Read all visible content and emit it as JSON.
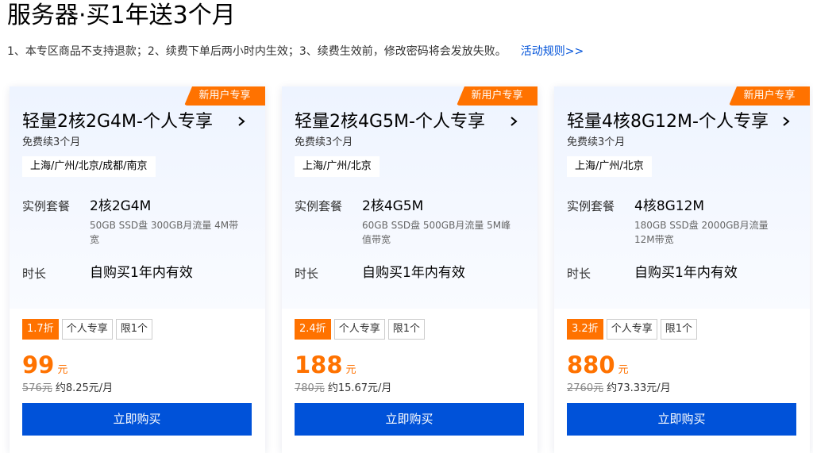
{
  "page": {
    "title": "服务器·买1年送3个月",
    "notice": "1、本专区商品不支持退款；2、续费下单后两小时内生效；3、续费生效前，修改密码将会发放失败。",
    "rules_link": "活动规则>>"
  },
  "labels": {
    "instance": "实例套餐",
    "duration": "时长",
    "buy": "立即购买"
  },
  "colors": {
    "accent_orange": "#ff7200",
    "primary_blue": "#0052d9"
  },
  "cards": [
    {
      "badge": "新用户专享",
      "title": "轻量2核2G4M-个人专享",
      "subtitle": "免费续3个月",
      "regions": "上海/广州/北京/成都/南京",
      "instance_value": "2核2G4M",
      "instance_desc": "50GB SSD盘 300GB月流量 4M带宽",
      "duration_value": "自购买1年内有效",
      "discount": "1.7折",
      "tag_personal": "个人专享",
      "tag_limit": "限1个",
      "price": "99",
      "price_unit": "元",
      "original_price": "576元",
      "monthly": "约8.25元/月"
    },
    {
      "badge": "新用户专享",
      "title": "轻量2核4G5M-个人专享",
      "subtitle": "免费续3个月",
      "regions": "上海/广州/北京",
      "instance_value": "2核4G5M",
      "instance_desc": "60GB SSD盘 500GB月流量 5M峰值带宽",
      "duration_value": "自购买1年内有效",
      "discount": "2.4折",
      "tag_personal": "个人专享",
      "tag_limit": "限1个",
      "price": "188",
      "price_unit": "元",
      "original_price": "780元",
      "monthly": "约15.67元/月"
    },
    {
      "badge": "新用户专享",
      "title": "轻量4核8G12M-个人专享",
      "subtitle": "免费续3个月",
      "regions": "上海/广州/北京",
      "instance_value": "4核8G12M",
      "instance_desc": "180GB SSD盘 2000GB月流量 12M带宽",
      "duration_value": "自购买1年内有效",
      "discount": "3.2折",
      "tag_personal": "个人专享",
      "tag_limit": "限1个",
      "price": "880",
      "price_unit": "元",
      "original_price": "2760元",
      "monthly": "约73.33元/月"
    }
  ]
}
